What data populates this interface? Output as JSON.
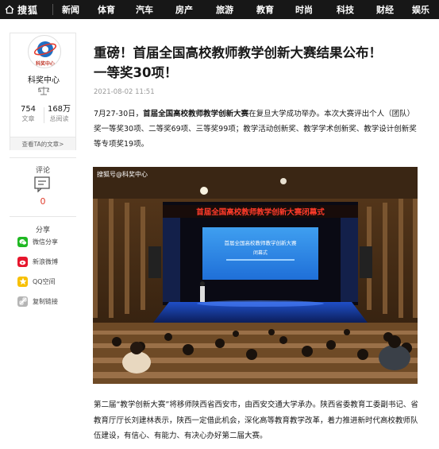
{
  "nav": {
    "brand": "搜狐",
    "items": [
      "新闻",
      "体育",
      "汽车",
      "房产",
      "旅游",
      "教育",
      "时尚",
      "科技",
      "财经",
      "娱乐"
    ]
  },
  "profile": {
    "logo_text": "科奖中心",
    "name": "科奖中心",
    "articles_count": "754",
    "articles_label": "文章",
    "reads_count": "168万",
    "reads_label": "总阅读",
    "view_all": "查看TA的文章>"
  },
  "comment": {
    "label": "评论",
    "count": "0"
  },
  "share": {
    "label": "分享",
    "items": [
      {
        "label": "微信分享",
        "icon": "wechat-icon",
        "color": "#1fb822"
      },
      {
        "label": "新浪微博",
        "icon": "weibo-icon",
        "color": "#e6162d"
      },
      {
        "label": "QQ空间",
        "icon": "qzone-icon",
        "color": "#f7c002"
      },
      {
        "label": "复制链接",
        "icon": "link-icon",
        "color": "#b5b5b5"
      }
    ]
  },
  "article": {
    "title_line1": "重磅！首届全国高校教师教学创新大赛结果公布！",
    "title_line2": "一等奖30项！",
    "date": "2021-08-02 11:51",
    "para1_pre": "7月27-30日，",
    "para1_bold": "首届全国高校教师教学创新大赛",
    "para1_post": "在复旦大学成功举办。本次大赛评出个人（团队）奖一等奖30项、二等奖69项、三等奖99项；教学活动创新奖、教学学术创新奖、教学设计创新奖等专项奖19项。",
    "photo_watermark": "搜狐号@科奖中心",
    "banner_text": "首届全国高校教师教学创新大赛闭幕式",
    "screen_title": "首届全国高校教师教学创新大赛",
    "screen_sub": "闭幕式",
    "para2": "第二届“教学创新大赛”将移师陕西省西安市，由西安交通大学承办。陕西省委教育工委副书记、省教育厅厅长刘建林表示，陕西一定借此机会，深化高等教育教学改革，着力推进新时代高校教师队伍建设，有信心、有能力、有决心办好第二届大赛。"
  },
  "colors": {
    "nav_bg": "#171717",
    "accent_red": "#e03b2b"
  }
}
